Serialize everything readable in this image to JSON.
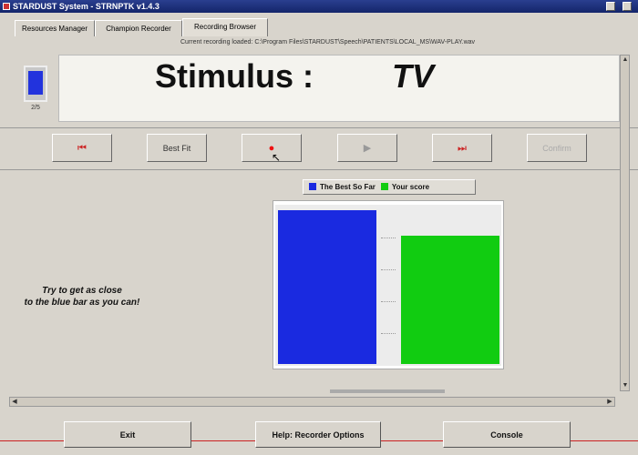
{
  "window": {
    "title": "STARDUST System - STRNPTK v1.4.3"
  },
  "tabs": [
    {
      "label": "Resources Manager"
    },
    {
      "label": "Champion Recorder"
    },
    {
      "label": "Recording Browser"
    }
  ],
  "path_text": "Current recording loaded: C:\\Program Files\\STARDUST\\Speech\\PATIENTS\\LOCAL_MS\\WAV-PLAY.wav",
  "indicator": {
    "label": "2/5"
  },
  "stimulus": {
    "label": "Stimulus :",
    "value": "TV"
  },
  "controls": [
    {
      "name": "first",
      "symbol": "⏮"
    },
    {
      "name": "best_fit",
      "label": "Best Fit"
    },
    {
      "name": "record",
      "symbol": "●"
    },
    {
      "name": "play",
      "symbol": "▶"
    },
    {
      "name": "last",
      "symbol": "⏭"
    },
    {
      "name": "confirm",
      "label": "Confirm"
    }
  ],
  "chart_data": {
    "type": "bar",
    "categories": [
      "The Best So Far",
      "Your score"
    ],
    "values": [
      96,
      80
    ],
    "ylim": [
      0,
      100
    ],
    "colors": [
      "#1a2ae0",
      "#11cc11"
    ],
    "legend_labels": [
      "The Best So Far",
      "Your score"
    ]
  },
  "instruction": {
    "line1": "Try to get as close",
    "line2": "to the blue bar as you can!"
  },
  "bottom_buttons": {
    "exit": "Exit",
    "help": "Help: Recorder Options",
    "console": "Console"
  },
  "colors": {
    "accent_red": "#cc2222",
    "blue_bar": "#1a2ae0",
    "green_bar": "#11cc11"
  }
}
